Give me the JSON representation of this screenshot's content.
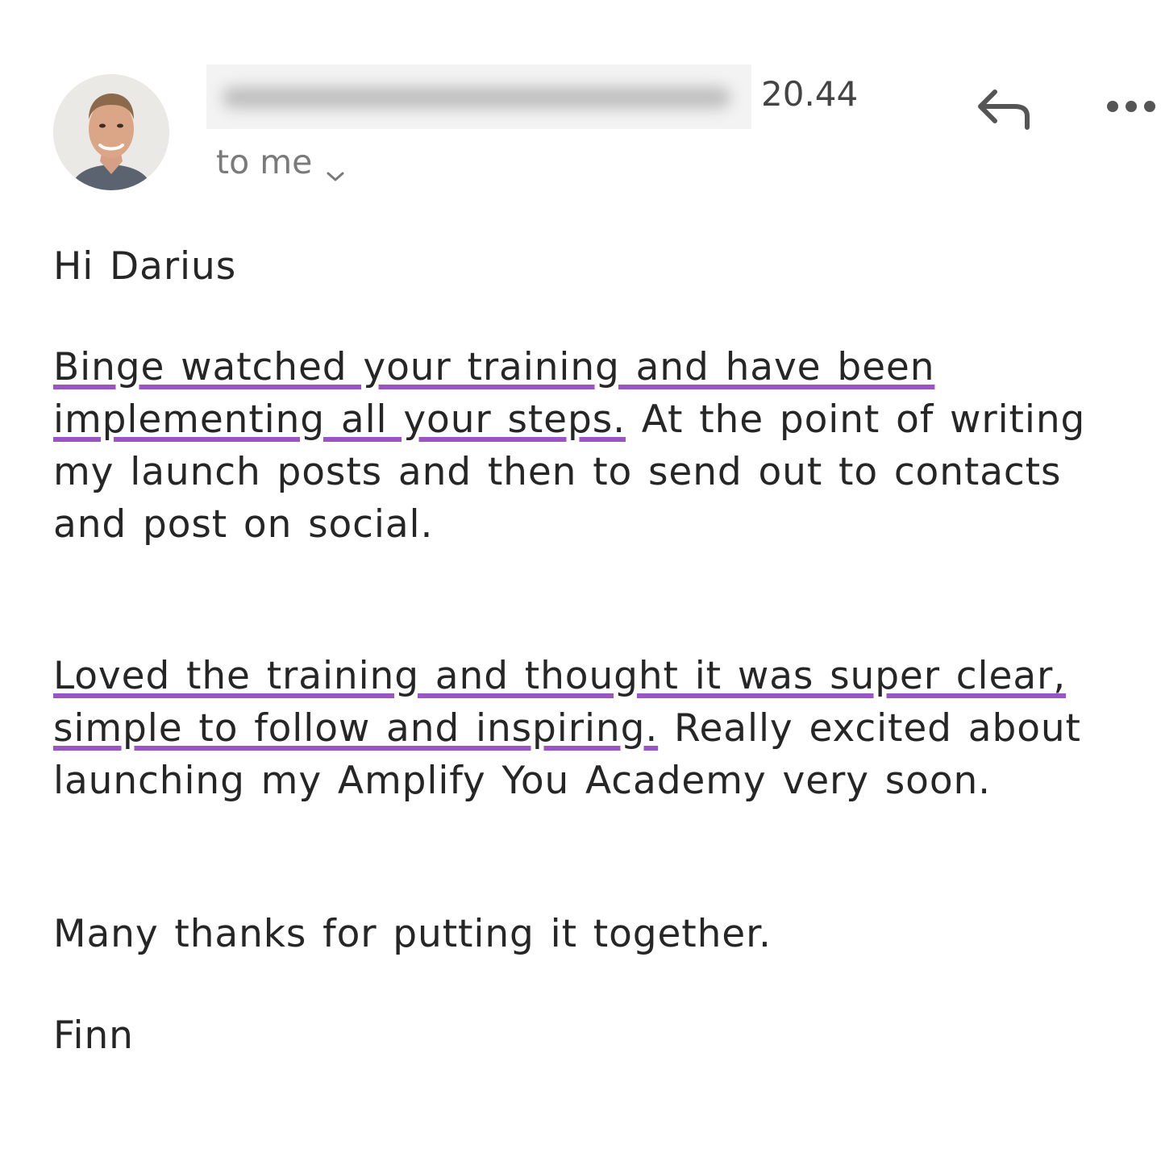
{
  "header": {
    "time": "20.44",
    "recipient": "to me"
  },
  "icons": {
    "reply": "reply-arrow-icon",
    "more": "more-horizontal-icon",
    "chevron": "chevron-down-icon"
  },
  "colors": {
    "highlight_underline": "#9b54c4",
    "body_text": "#262626",
    "muted_text": "#7a7a7a"
  },
  "message": {
    "greeting": "Hi Darius",
    "para1": {
      "highlighted": "Binge watched your training and have been implementing all your steps.",
      "rest": " At the point of writing my launch posts and then to send out to contacts and post on social."
    },
    "para2": {
      "highlighted": "Loved the training and thought it was super clear, simple to follow and inspiring.",
      "rest": " Really excited about launching my Amplify You Academy very soon."
    },
    "thanks": "Many thanks for putting it together.",
    "signoff": "Finn"
  }
}
